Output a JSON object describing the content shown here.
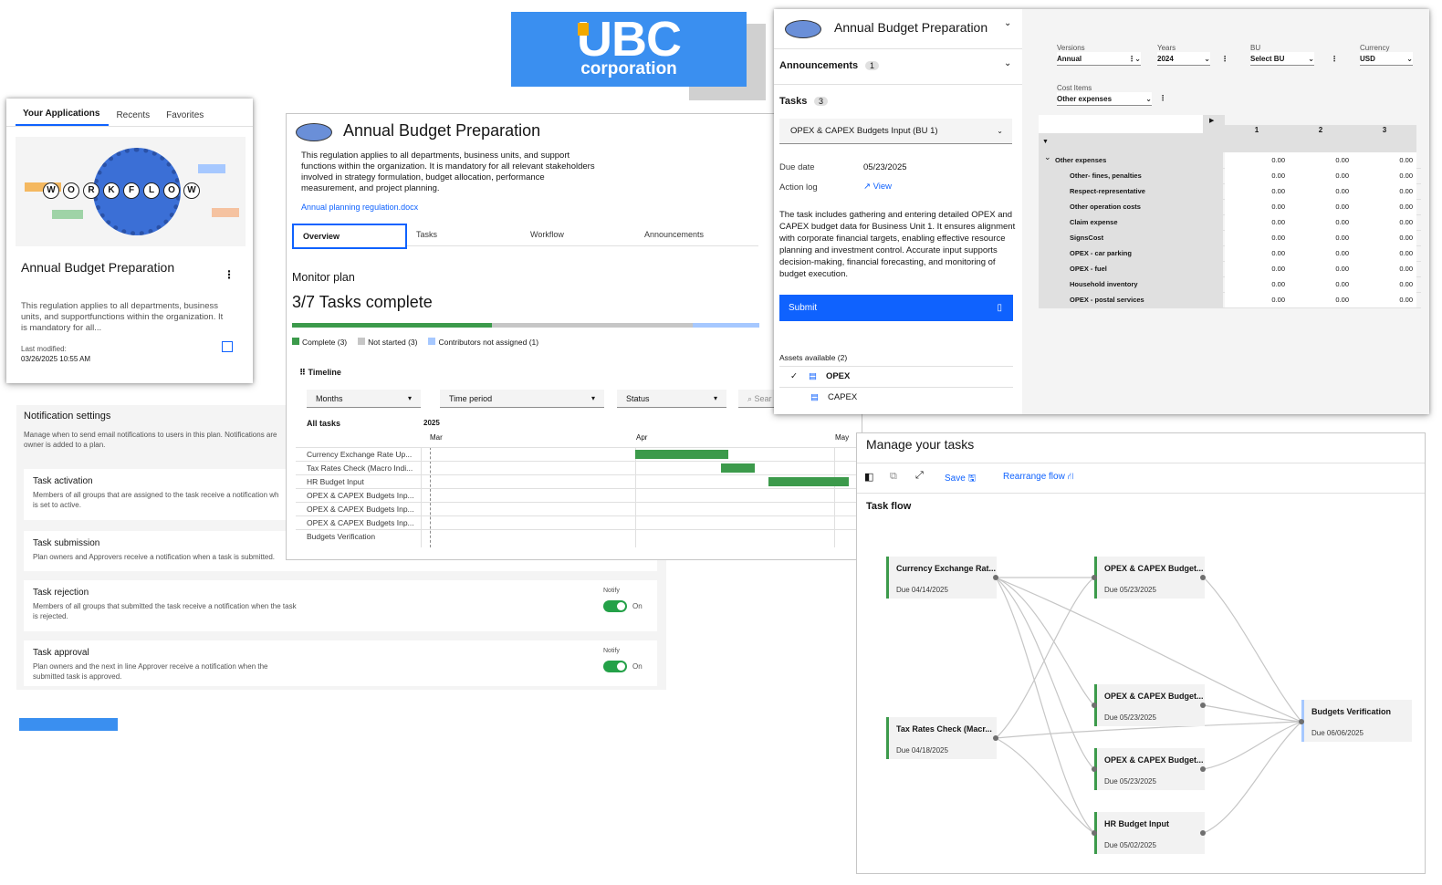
{
  "logo": {
    "line1": "UBC",
    "line2": "corporation"
  },
  "app_card": {
    "tabs": [
      "Your Applications",
      "Recents",
      "Favorites"
    ],
    "image_letters": [
      "W",
      "O",
      "R",
      "K",
      "F",
      "L",
      "O",
      "W"
    ],
    "title": "Annual Budget Preparation",
    "description": "This regulation applies to all departments, business units, and supportfunctions within the organization. It is mandatory for all...",
    "modified_label": "Last modified:",
    "modified_value": "03/26/2025 10:55 AM"
  },
  "notifications": {
    "title": "Notification settings",
    "description": "Manage when to send email notifications to users in this plan. Notifications are",
    "description2": "owner is added to a plan.",
    "items": [
      {
        "title": "Task activation",
        "desc": "Members of all groups that are assigned to the task receive a notification wh",
        "desc2": "is set to active."
      },
      {
        "title": "Task submission",
        "desc": "Plan owners and Approvers receive a notification when a task is submitted.",
        "desc2": ""
      },
      {
        "title": "Task rejection",
        "desc": "Members of all groups that submitted the task receive a notification when the task",
        "desc2": "is rejected.",
        "notify": "Notify",
        "state": "On"
      },
      {
        "title": "Task approval",
        "desc": "Plan owners and the next in line Approver receive a notification when the",
        "desc2": "submitted task is approved.",
        "notify": "Notify",
        "state": "On"
      }
    ]
  },
  "overview": {
    "title": "Annual Budget Preparation",
    "description": "This regulation applies to all departments, business units, and support functions within the organization. It is mandatory for all relevant stakeholders involved in strategy formulation, budget allocation, performance measurement, and project planning.",
    "link": "Annual planning regulation.docx",
    "tabs": [
      "Overview",
      "Tasks",
      "Workflow",
      "Announcements"
    ],
    "monitor_label": "Monitor plan",
    "progress_text": "3/7 Tasks complete",
    "progress": {
      "complete": 3,
      "not_started": 3,
      "unassigned": 1,
      "total": 7
    },
    "legend": [
      "Complete (3)",
      "Not started (3)",
      "Contributors not assigned (1)"
    ],
    "colors": {
      "complete": "#3c9a4b",
      "not_started": "#c6c6c6",
      "unassigned": "#a6c8ff"
    },
    "timeline_title": "Timeline",
    "filters": [
      "Months",
      "Time period",
      "Status",
      "Sear"
    ],
    "all_tasks": "All tasks",
    "year": "2025",
    "months": [
      "Mar",
      "Apr",
      "May"
    ],
    "tasks": [
      "Currency Exchange Rate Up...",
      "Tax Rates Check (Macro Indi...",
      "HR Budget Input",
      "OPEX & CAPEX Budgets Inp...",
      "OPEX & CAPEX Budgets Inp...",
      "OPEX & CAPEX Budgets Inp...",
      "Budgets Verification"
    ]
  },
  "task_panel": {
    "title": "Annual Budget Preparation",
    "announcements_label": "Announcements",
    "announcements_count": "1",
    "tasks_label": "Tasks",
    "tasks_count": "3",
    "selected_task": "OPEX & CAPEX Budgets Input (BU 1)",
    "due_label": "Due date",
    "due_value": "05/23/2025",
    "action_label": "Action log",
    "action_link": "View",
    "description": "The task includes gathering and entering detailed OPEX and CAPEX budget data for Business Unit 1. It ensures alignment with corporate financial targets, enabling effective resource planning and investment control. Accurate input supports decision-making, financial forecasting, and monitoring of budget execution.",
    "submit": "Submit",
    "assets_label": "Assets available (2)",
    "assets": [
      "OPEX",
      "CAPEX"
    ]
  },
  "grid": {
    "selectors": [
      {
        "label": "Versions",
        "value": "Annual"
      },
      {
        "label": "Years",
        "value": "2024"
      },
      {
        "label": "BU",
        "value": "Select BU"
      },
      {
        "label": "Currency",
        "value": "USD"
      }
    ],
    "cost_items": {
      "label": "Cost Items",
      "value": "Other expenses"
    },
    "columns": [
      "1",
      "2",
      "3"
    ],
    "rows": [
      {
        "name": "Other expenses",
        "values": [
          "0.00",
          "0.00",
          "0.00"
        ]
      },
      {
        "name": "Other- fines, penalties",
        "values": [
          "0.00",
          "0.00",
          "0.00"
        ]
      },
      {
        "name": "Respect-representative",
        "values": [
          "0.00",
          "0.00",
          "0.00"
        ]
      },
      {
        "name": "Other operation costs",
        "values": [
          "0.00",
          "0.00",
          "0.00"
        ]
      },
      {
        "name": "Claim expense",
        "values": [
          "0.00",
          "0.00",
          "0.00"
        ]
      },
      {
        "name": "SignsCost",
        "values": [
          "0.00",
          "0.00",
          "0.00"
        ]
      },
      {
        "name": "OPEX - car parking",
        "values": [
          "0.00",
          "0.00",
          "0.00"
        ]
      },
      {
        "name": "OPEX - fuel",
        "values": [
          "0.00",
          "0.00",
          "0.00"
        ]
      },
      {
        "name": "Household inventory",
        "values": [
          "0.00",
          "0.00",
          "0.00"
        ]
      },
      {
        "name": "OPEX - postal services",
        "values": [
          "0.00",
          "0.00",
          "0.00"
        ]
      }
    ]
  },
  "flow": {
    "title": "Manage your tasks",
    "save": "Save",
    "rearrange": "Rearrange flow",
    "subtitle": "Task flow",
    "nodes": [
      {
        "name": "Currency Exchange Rat...",
        "due": "Due 04/14/2025"
      },
      {
        "name": "Tax Rates Check (Macr...",
        "due": "Due 04/18/2025"
      },
      {
        "name": "OPEX & CAPEX Budget...",
        "due": "Due 05/23/2025"
      },
      {
        "name": "OPEX & CAPEX Budget...",
        "due": "Due 05/23/2025"
      },
      {
        "name": "OPEX & CAPEX Budget...",
        "due": "Due 05/23/2025"
      },
      {
        "name": "HR Budget Input",
        "due": "Due 05/02/2025"
      },
      {
        "name": "Budgets Verification",
        "due": "Due 06/06/2025"
      }
    ]
  }
}
